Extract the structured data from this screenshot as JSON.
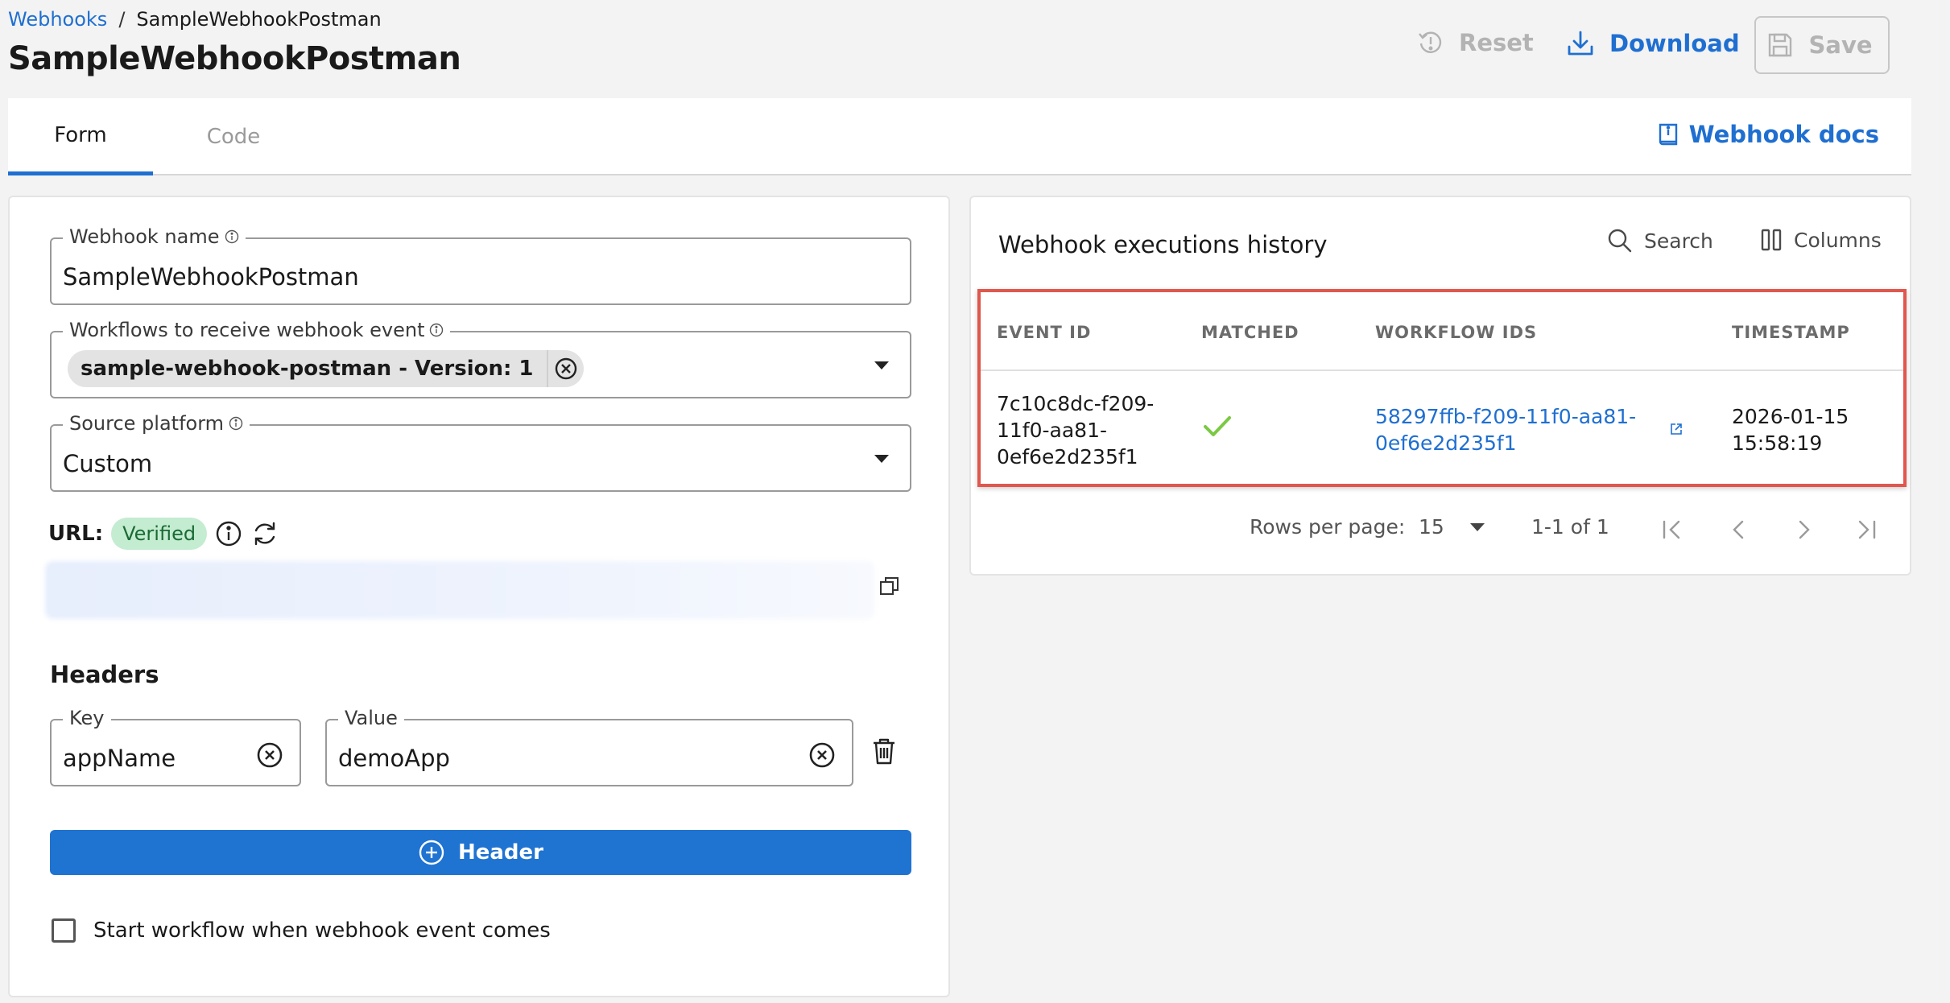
{
  "breadcrumb": {
    "parent": "Webhooks",
    "separator": "/",
    "current": "SampleWebhookPostman"
  },
  "page_title": "SampleWebhookPostman",
  "actions": {
    "reset": "Reset",
    "download": "Download",
    "save": "Save"
  },
  "tabs": [
    {
      "label": "Form",
      "active": true
    },
    {
      "label": "Code",
      "active": false
    }
  ],
  "docs_link": "Webhook docs",
  "form": {
    "webhook_name": {
      "label": "Webhook name",
      "value": "SampleWebhookPostman"
    },
    "workflows": {
      "label": "Workflows to receive webhook event",
      "chip": "sample-webhook-postman - Version: 1"
    },
    "source_platform": {
      "label": "Source platform",
      "value": "Custom"
    },
    "url": {
      "label": "URL:",
      "badge": "Verified"
    },
    "headers": {
      "title": "Headers",
      "key_label": "Key",
      "key_value": "appName",
      "value_label": "Value",
      "value_value": "demoApp",
      "add_button": "Header"
    },
    "start_workflow_label": "Start workflow when webhook event comes"
  },
  "history": {
    "title": "Webhook executions history",
    "search": "Search",
    "columns": "Columns",
    "headers": [
      "EVENT ID",
      "MATCHED",
      "WORKFLOW IDS",
      "TIMESTAMP"
    ],
    "rows": [
      {
        "event_id": [
          "7c10c8dc-f209-",
          "11f0-aa81-",
          "0ef6e2d235f1"
        ],
        "matched": true,
        "workflow_id": [
          "58297ffb-f209-11f0-aa81-",
          "0ef6e2d235f1"
        ],
        "timestamp": [
          "2026-01-15",
          "15:58:19"
        ]
      }
    ],
    "pagination": {
      "rows_per_page_label": "Rows per page:",
      "rows_per_page": "15",
      "range": "1-1 of 1"
    }
  },
  "colors": {
    "accent": "#1f6fd1",
    "verified_bg": "#c4ecd1",
    "highlight": "#e0574e",
    "check": "#7ac943"
  }
}
